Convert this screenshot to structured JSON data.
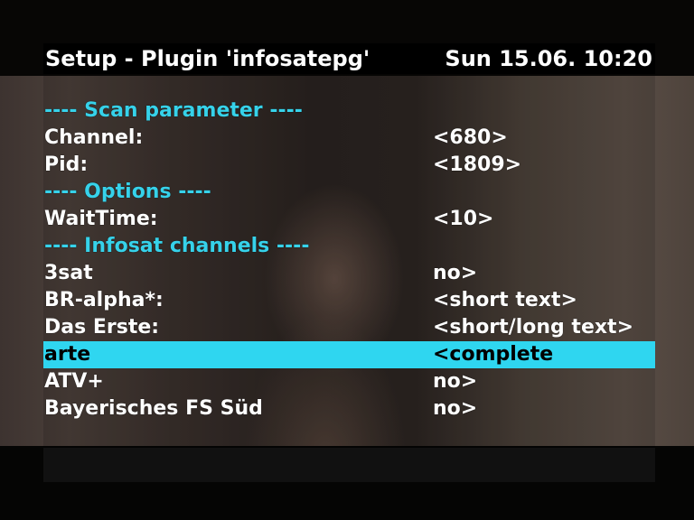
{
  "header": {
    "title": "Setup - Plugin 'infosatepg'",
    "datetime": "Sun 15.06. 10:20"
  },
  "menu": {
    "rows": [
      {
        "label": "---- Scan parameter ----",
        "value": "",
        "type": "section"
      },
      {
        "label": "Channel:",
        "value": "<680>",
        "type": "item"
      },
      {
        "label": "Pid:",
        "value": "<1809>",
        "type": "item"
      },
      {
        "label": "---- Options ----",
        "value": "",
        "type": "section"
      },
      {
        "label": "WaitTime:",
        "value": "<10>",
        "type": "item"
      },
      {
        "label": "---- Infosat channels ----",
        "value": "",
        "type": "section"
      },
      {
        "label": "3sat",
        "value": "no>",
        "type": "item"
      },
      {
        "label": "BR-alpha*:",
        "value": "<short text>",
        "type": "item"
      },
      {
        "label": "Das Erste:",
        "value": "<short/long text>",
        "type": "item"
      },
      {
        "label": "arte",
        "value": "<complete",
        "type": "item",
        "selected": true
      },
      {
        "label": "ATV+",
        "value": "no>",
        "type": "item"
      },
      {
        "label": "Bayerisches FS Süd",
        "value": "no>",
        "type": "item"
      }
    ]
  },
  "colors": {
    "section_text": "#36d2ea",
    "selection_bar": "#2fd6f0",
    "text": "#ffffff",
    "osd_background": "#000000"
  }
}
